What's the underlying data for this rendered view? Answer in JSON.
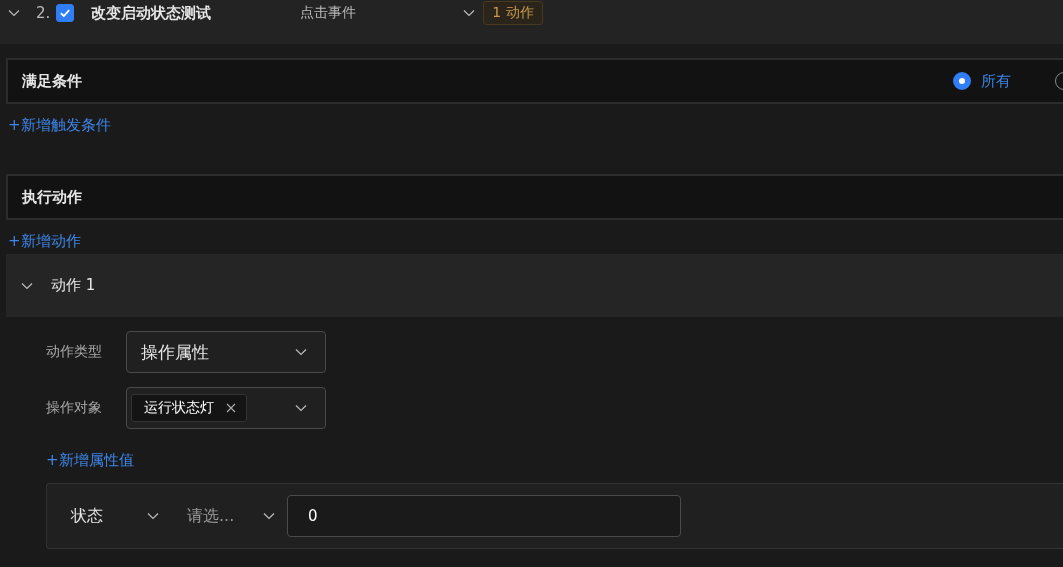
{
  "rule": {
    "expanded": true,
    "number": "2.",
    "checked": true,
    "title": "改变启动状态测试",
    "trigger": "点击事件",
    "badge": "1 动作"
  },
  "conditions": {
    "title": "满足条件",
    "radios": [
      {
        "label": "所有",
        "selected": true
      },
      {
        "selected": false
      }
    ],
    "add_link": "+新增触发条件"
  },
  "actions": {
    "title": "执行动作",
    "add_link": "+新增动作"
  },
  "action": {
    "expanded": true,
    "title": "动作 1",
    "fields": [
      {
        "label": "动作类型",
        "kind": "select",
        "value": "操作属性"
      },
      {
        "label": "操作对象",
        "kind": "tags",
        "tags": [
          "运行状态灯"
        ]
      }
    ],
    "add_property_link": "+新增属性值",
    "property": {
      "name": "状态",
      "operator_placeholder": "请选...",
      "value": "0"
    }
  }
}
